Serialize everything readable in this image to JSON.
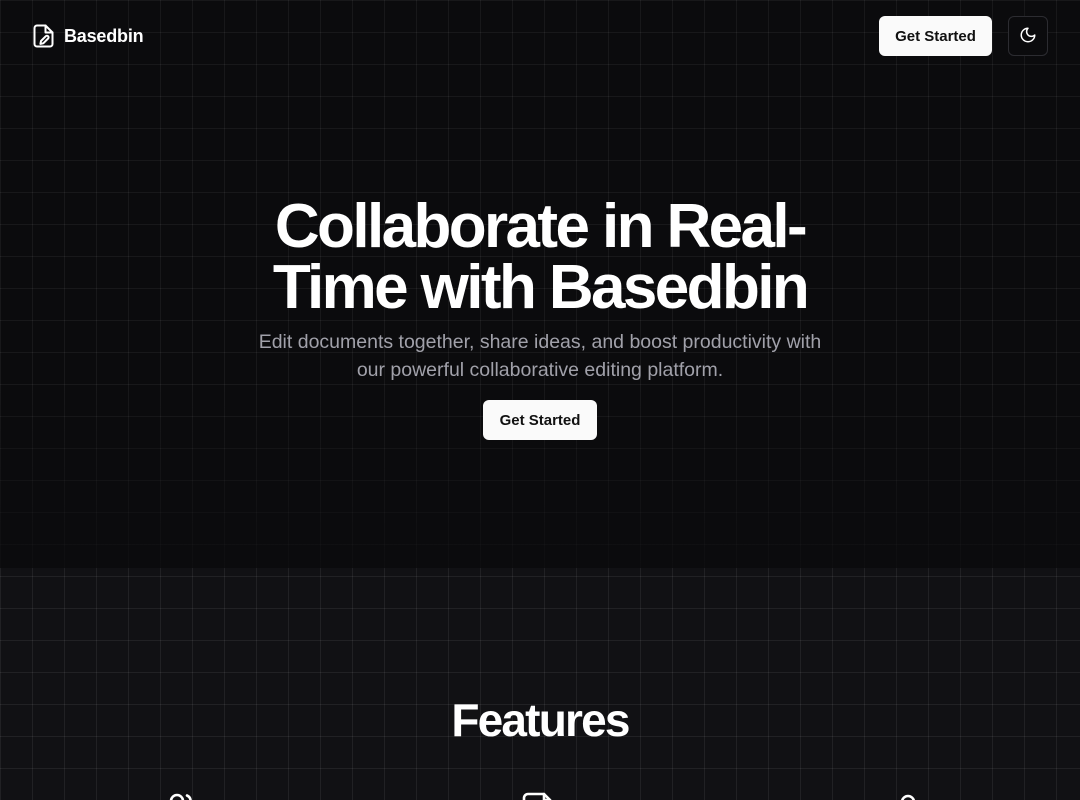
{
  "header": {
    "brand_name": "Basedbin",
    "brand_icon": "file-edit-icon",
    "cta_label": "Get Started",
    "theme_toggle_icon": "moon-icon"
  },
  "hero": {
    "title": "Collaborate in Real-Time with Basedbin",
    "subtitle": "Edit documents together, share ideas, and boost productivity with our powerful collaborative editing platform.",
    "cta_label": "Get Started"
  },
  "features": {
    "title": "Features",
    "icons": [
      "users-icon",
      "file-edit-icon",
      "lock-icon"
    ]
  },
  "colors": {
    "background": "#0b0b0d",
    "primary_button": "#fafafa",
    "muted_text": "#a1a1aa"
  }
}
